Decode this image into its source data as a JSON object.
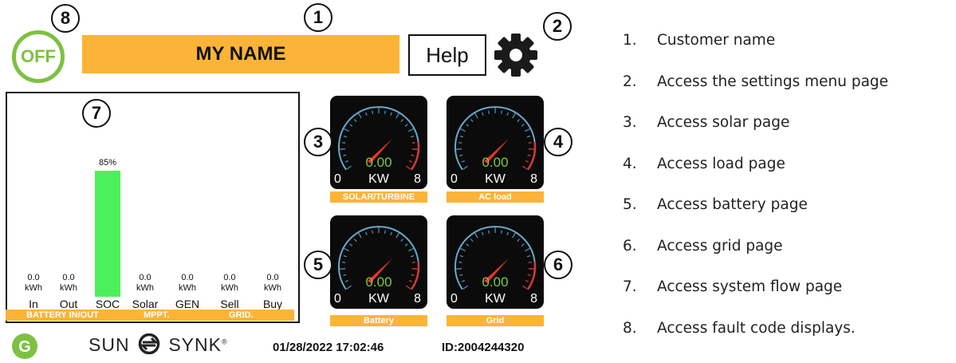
{
  "header": {
    "off_label": "OFF",
    "customer_name": "MY NAME",
    "help_label": "Help",
    "settings_icon": "gear-icon"
  },
  "callouts": [
    "1",
    "2",
    "3",
    "4",
    "5",
    "6",
    "7",
    "8"
  ],
  "chart_data": {
    "type": "bar",
    "categories": [
      "In",
      "Out",
      "SOC",
      "Solar",
      "GEN",
      "Sell",
      "Buy"
    ],
    "values": [
      0.0,
      0.0,
      85,
      0.0,
      0.0,
      0.0,
      0.0
    ],
    "value_labels": [
      "0.0",
      "0.0",
      "85%",
      "0.0",
      "0.0",
      "0.0",
      "0.0"
    ],
    "units": [
      "kWh",
      "kWh",
      "",
      "kWh",
      "kWh",
      "kWh",
      "kWh"
    ],
    "group_labels": [
      "BATTERY IN/OUT",
      "MPPT.",
      "GRID."
    ],
    "ylim": [
      0,
      100
    ],
    "bar_color": "#4cf05a"
  },
  "gauges": [
    {
      "label": "SOLAR/TURBINE",
      "value": "0.00",
      "min": "0",
      "max": "8",
      "unit": "KW"
    },
    {
      "label": "AC load",
      "value": "0.00",
      "min": "0",
      "max": "8",
      "unit": "KW"
    },
    {
      "label": "Battery",
      "value": "0.00",
      "min": "0",
      "max": "8",
      "unit": "KW"
    },
    {
      "label": "Grid",
      "value": "0.00",
      "min": "0",
      "max": "8",
      "unit": "KW"
    }
  ],
  "footer": {
    "logo_letter": "G",
    "brand_left": "SUN",
    "brand_right": "SYNK",
    "brand_mark": "®",
    "datetime": "01/28/2022  17:02:46",
    "device_id": "ID:2004244320"
  },
  "legend": [
    {
      "num": "1.",
      "text": "Customer name"
    },
    {
      "num": "2.",
      "text": "Access the settings menu page"
    },
    {
      "num": "3.",
      "text": "Access solar page"
    },
    {
      "num": "4.",
      "text": "Access load page"
    },
    {
      "num": "5.",
      "text": "Access battery page"
    },
    {
      "num": "6.",
      "text": "Access grid page"
    },
    {
      "num": "7.",
      "text": "Access system flow page"
    },
    {
      "num": "8.",
      "text": "Access fault code displays."
    }
  ],
  "colors": {
    "accent_orange": "#fbb437",
    "status_green": "#7dc142",
    "gauge_bg": "#0b0b0b",
    "needle_red": "#e8332c"
  }
}
